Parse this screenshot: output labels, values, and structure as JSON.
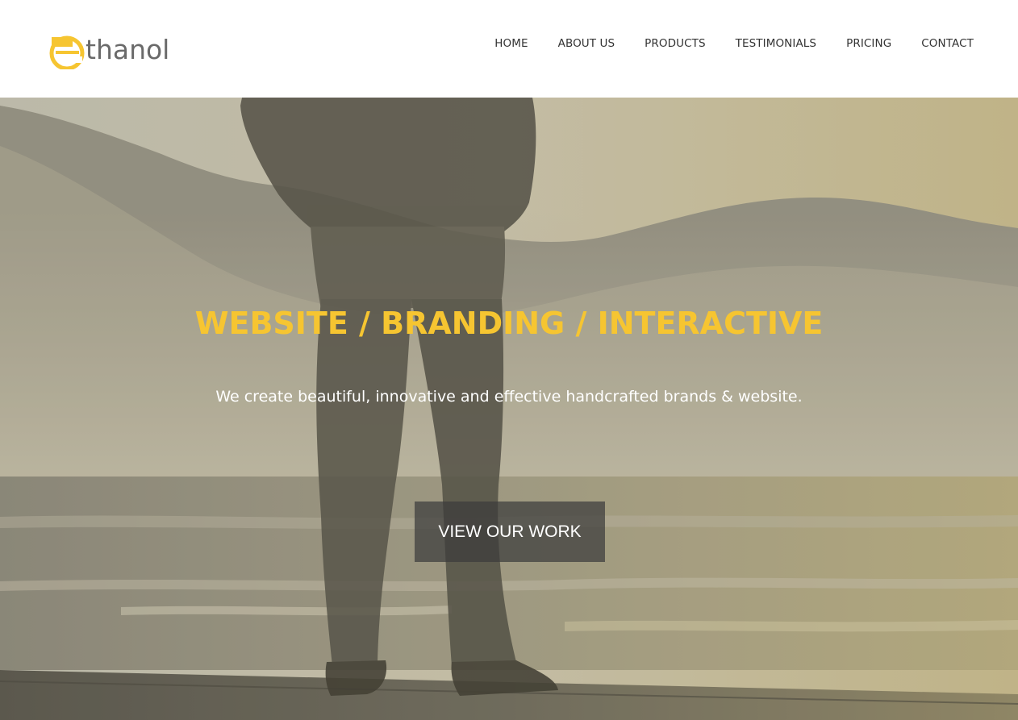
{
  "brand": {
    "logo_text": "thanol",
    "logo_letter": "e",
    "accent_color": "#f6c531"
  },
  "nav": {
    "items": [
      {
        "label": "HOME"
      },
      {
        "label": "ABOUT US"
      },
      {
        "label": "PRODUCTS"
      },
      {
        "label": "TESTIMONIALS"
      },
      {
        "label": "PRICING"
      },
      {
        "label": "CONTACT"
      }
    ]
  },
  "hero": {
    "title": "WEBSITE / BRANDING / INTERACTIVE",
    "subtitle": "We create beautiful, innovative and effective handcrafted brands & website.",
    "cta_label": "VIEW OUR WORK",
    "title_color": "#f6c531"
  }
}
